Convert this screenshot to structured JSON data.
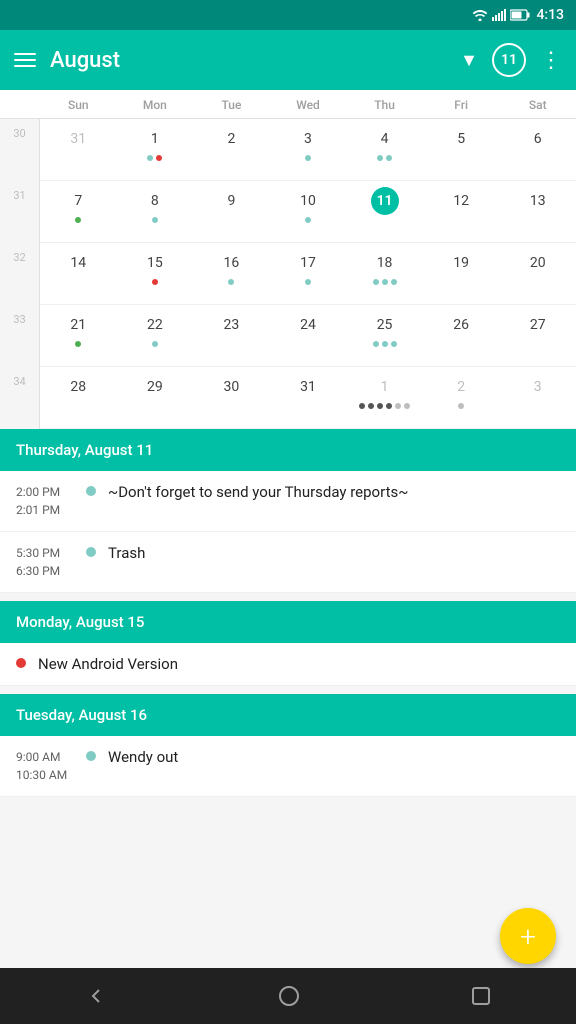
{
  "statusBar": {
    "time": "4:13",
    "icons": [
      "wifi",
      "signal",
      "battery"
    ]
  },
  "toolbar": {
    "menuLabel": "menu",
    "title": "August",
    "dropdownLabel": "▼",
    "todayBadge": "11",
    "moreLabel": "⋮"
  },
  "calendar": {
    "daysOfWeek": [
      "Sun",
      "Mon",
      "Tue",
      "Wed",
      "Thu",
      "Fri",
      "Sat"
    ],
    "weeks": [
      {
        "weekNum": "30",
        "days": [
          {
            "num": "31",
            "otherMonth": true,
            "dots": []
          },
          {
            "num": "1",
            "dots": [
              "teal",
              "red"
            ]
          },
          {
            "num": "2",
            "dots": []
          },
          {
            "num": "3",
            "dots": [
              "teal"
            ]
          },
          {
            "num": "4",
            "dots": [
              "teal",
              "teal"
            ]
          },
          {
            "num": "5",
            "dots": []
          },
          {
            "num": "6",
            "dots": []
          }
        ]
      },
      {
        "weekNum": "31",
        "days": [
          {
            "num": "7",
            "dots": [
              "green"
            ]
          },
          {
            "num": "8",
            "dots": [
              "teal"
            ]
          },
          {
            "num": "9",
            "dots": []
          },
          {
            "num": "10",
            "dots": [
              "teal"
            ]
          },
          {
            "num": "11",
            "today": true,
            "dots": []
          },
          {
            "num": "12",
            "dots": []
          },
          {
            "num": "13",
            "dots": []
          }
        ]
      },
      {
        "weekNum": "32",
        "days": [
          {
            "num": "14",
            "dots": []
          },
          {
            "num": "15",
            "dots": [
              "red"
            ]
          },
          {
            "num": "16",
            "dots": [
              "teal"
            ]
          },
          {
            "num": "17",
            "dots": [
              "teal"
            ]
          },
          {
            "num": "18",
            "dots": [
              "teal",
              "teal",
              "teal"
            ]
          },
          {
            "num": "19",
            "dots": []
          },
          {
            "num": "20",
            "dots": []
          }
        ]
      },
      {
        "weekNum": "33",
        "days": [
          {
            "num": "21",
            "dots": [
              "green"
            ]
          },
          {
            "num": "22",
            "dots": [
              "teal"
            ]
          },
          {
            "num": "23",
            "dots": []
          },
          {
            "num": "24",
            "dots": []
          },
          {
            "num": "25",
            "dots": [
              "teal",
              "teal",
              "teal"
            ]
          },
          {
            "num": "26",
            "dots": []
          },
          {
            "num": "27",
            "dots": []
          }
        ]
      },
      {
        "weekNum": "34",
        "days": [
          {
            "num": "28",
            "dots": []
          },
          {
            "num": "29",
            "dots": []
          },
          {
            "num": "30",
            "dots": []
          },
          {
            "num": "31",
            "dots": []
          },
          {
            "num": "1",
            "otherMonth": true,
            "dots": [
              "dark",
              "dark",
              "dark",
              "dark",
              "gray",
              "gray"
            ]
          },
          {
            "num": "2",
            "otherMonth": true,
            "dots": [
              "gray"
            ]
          },
          {
            "num": "3",
            "otherMonth": true,
            "dots": []
          }
        ]
      }
    ]
  },
  "eventSections": [
    {
      "date": "Thursday, August 11",
      "events": [
        {
          "timeStart": "2:00 PM",
          "timeEnd": "2:01 PM",
          "dotColor": "teal",
          "title": "~Don't forget to send your Thursday reports~",
          "allDay": false
        },
        {
          "timeStart": "5:30 PM",
          "timeEnd": "6:30 PM",
          "dotColor": "teal",
          "title": "Trash",
          "allDay": false
        }
      ]
    },
    {
      "date": "Monday, August 15",
      "events": [
        {
          "timeStart": "",
          "timeEnd": "",
          "dotColor": "red",
          "title": "New Android Version",
          "allDay": true
        }
      ]
    },
    {
      "date": "Tuesday, August 16",
      "events": [
        {
          "timeStart": "9:00 AM",
          "timeEnd": "10:30 AM",
          "dotColor": "teal",
          "title": "Wendy out",
          "allDay": false
        }
      ]
    }
  ],
  "fab": {
    "label": "+"
  },
  "navBar": {
    "back": "‹",
    "home": "○",
    "square": "☐"
  }
}
